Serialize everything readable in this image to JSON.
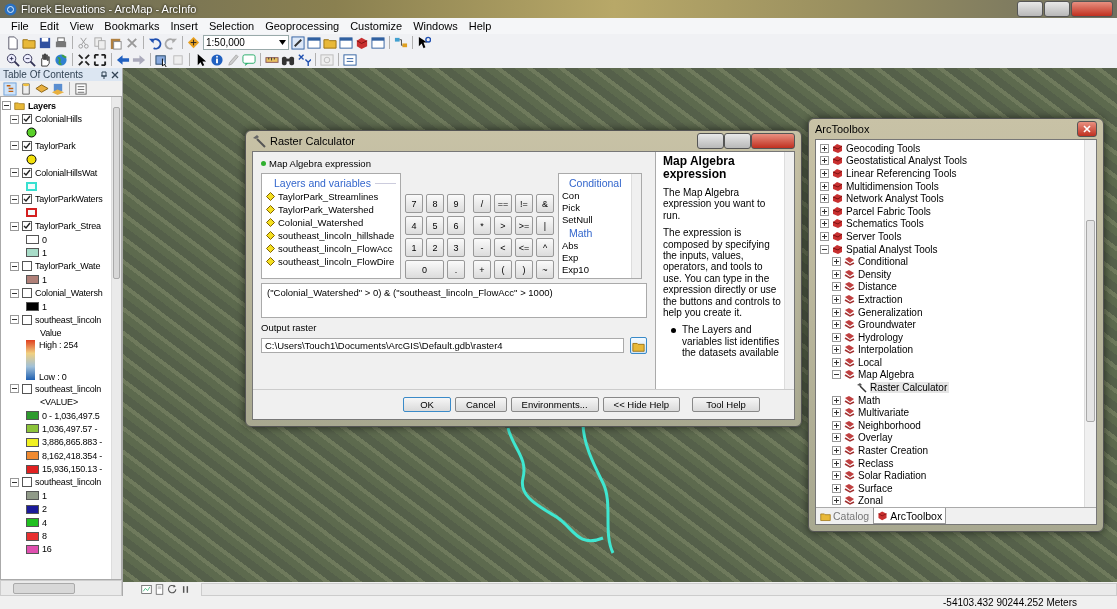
{
  "window": {
    "title": "Florek Elevations - ArcMap - ArcInfo"
  },
  "menu": [
    "File",
    "Edit",
    "View",
    "Bookmarks",
    "Insert",
    "Selection",
    "Geoprocessing",
    "Customize",
    "Windows",
    "Help"
  ],
  "toolbar": {
    "scale": "1:50,000"
  },
  "toc": {
    "title": "Table Of Contents",
    "root": {
      "label": "Layers",
      "expanded": true
    },
    "layers": [
      {
        "label": "ColonialHills",
        "checked": true,
        "expanded": true,
        "legend": [
          {
            "kind": "point",
            "color": "#5ad02a"
          }
        ]
      },
      {
        "label": "TaylorPark",
        "checked": true,
        "expanded": true,
        "legend": [
          {
            "kind": "point",
            "color": "#f2e00a"
          }
        ]
      },
      {
        "label": "ColonialHillsWat",
        "checked": true,
        "expanded": true,
        "legend": [
          {
            "kind": "outline",
            "color": "#38e0d0"
          }
        ]
      },
      {
        "label": "TaylorParkWaters",
        "checked": true,
        "expanded": true,
        "legend": [
          {
            "kind": "outline",
            "color": "#d42020"
          }
        ]
      },
      {
        "label": "TaylorPark_Strea",
        "checked": true,
        "expanded": true,
        "legend": [
          {
            "kind": "swatch",
            "color": "#ffffff",
            "label": "0"
          },
          {
            "kind": "swatch",
            "color": "#a8dcc8",
            "label": "1"
          }
        ]
      },
      {
        "label": "TaylorPark_Wate",
        "checked": false,
        "expanded": true,
        "legend": [
          {
            "kind": "swatch",
            "color": "#b08078",
            "label": "1"
          }
        ]
      },
      {
        "label": "Colonial_Watersh",
        "checked": false,
        "expanded": true,
        "legend": [
          {
            "kind": "swatch",
            "color": "#000000",
            "label": "1"
          }
        ]
      },
      {
        "label": "southeast_lincoln",
        "checked": false,
        "expanded": true,
        "legend": [
          {
            "kind": "heading",
            "label": "Value"
          },
          {
            "kind": "ramp",
            "high": "High : 254",
            "low": "Low : 0"
          }
        ]
      },
      {
        "label": "southeast_lincoln",
        "checked": false,
        "expanded": true,
        "legend": [
          {
            "kind": "heading",
            "label": "<VALUE>"
          },
          {
            "kind": "swatch",
            "color": "#2e9a2e",
            "label": "0 - 1,036,497.5"
          },
          {
            "kind": "swatch",
            "color": "#8cc43a",
            "label": "1,036,497.57 -"
          },
          {
            "kind": "swatch",
            "color": "#f0f020",
            "label": "3,886,865.883 -"
          },
          {
            "kind": "swatch",
            "color": "#f08a30",
            "label": "8,162,418.354 -"
          },
          {
            "kind": "swatch",
            "color": "#e02020",
            "label": "15,936,150.13 -"
          }
        ]
      },
      {
        "label": "southeast_lincoln",
        "checked": false,
        "expanded": true,
        "legend": [
          {
            "kind": "swatch",
            "color": "#909a88",
            "label": "1"
          },
          {
            "kind": "swatch",
            "color": "#1a1a9a",
            "label": "2"
          },
          {
            "kind": "swatch",
            "color": "#20c020",
            "label": "4"
          },
          {
            "kind": "swatch",
            "color": "#e83030",
            "label": "8"
          },
          {
            "kind": "swatch",
            "color": "#e050b0",
            "label": "16"
          }
        ]
      }
    ]
  },
  "raster_calculator": {
    "title": "Raster Calculator",
    "section_label": "Map Algebra expression",
    "layers_heading": "Layers and variables",
    "layers": [
      "TaylorPark_Streamlines",
      "TaylorPark_Watershed",
      "Colonial_Watershed",
      "southeast_lincoln_hillshade",
      "southeast_lincoln_FlowAcc",
      "southeast_lincoln_FlowDire"
    ],
    "keypad_digits": [
      "7",
      "8",
      "9",
      "4",
      "5",
      "6",
      "1",
      "2",
      "3",
      "0",
      "."
    ],
    "keypad_operators": [
      "/",
      "==",
      "!=",
      "&",
      "*",
      ">",
      ">=",
      "|",
      "-",
      "<",
      "<=",
      "^",
      "+",
      "(",
      ")",
      "~"
    ],
    "functions": [
      {
        "kind": "heading",
        "label": "Conditional"
      },
      {
        "kind": "item",
        "label": "Con"
      },
      {
        "kind": "item",
        "label": "Pick"
      },
      {
        "kind": "item",
        "label": "SetNull"
      },
      {
        "kind": "heading",
        "label": "Math"
      },
      {
        "kind": "item",
        "label": "Abs"
      },
      {
        "kind": "item",
        "label": "Exp"
      },
      {
        "kind": "item",
        "label": "Exp10"
      }
    ],
    "expression": "(\"Colonial_Watershed\" > 0) & (\"southeast_lincoln_FlowAcc\" > 1000)",
    "output_label": "Output raster",
    "output_value": "C:\\Users\\Touch1\\Documents\\ArcGIS\\Default.gdb\\raster4",
    "help": {
      "title": "Map Algebra expression",
      "paragraphs": [
        "The Map Algebra expression you want to run.",
        "The expression is composed by specifying the inputs, values, operators, and tools to use. You can type in the expression directly or use the buttons and controls to help you create it."
      ],
      "bullets": [
        "The Layers and variables list identifies the datasets available"
      ]
    },
    "buttons": [
      {
        "label": "OK",
        "default": true
      },
      {
        "label": "Cancel",
        "default": false
      },
      {
        "label": "Environments...",
        "default": false
      },
      {
        "label": "<< Hide Help",
        "default": false
      },
      {
        "label": "Tool Help",
        "default": false
      }
    ]
  },
  "toolbox": {
    "title": "ArcToolbox",
    "items": [
      {
        "label": "Geocoding Tools",
        "kind": "toolbox",
        "expanded": false
      },
      {
        "label": "Geostatistical Analyst Tools",
        "kind": "toolbox",
        "expanded": false
      },
      {
        "label": "Linear Referencing Tools",
        "kind": "toolbox",
        "expanded": false
      },
      {
        "label": "Multidimension Tools",
        "kind": "toolbox",
        "expanded": false
      },
      {
        "label": "Network Analyst Tools",
        "kind": "toolbox",
        "expanded": false
      },
      {
        "label": "Parcel Fabric Tools",
        "kind": "toolbox",
        "expanded": false
      },
      {
        "label": "Schematics Tools",
        "kind": "toolbox",
        "expanded": false
      },
      {
        "label": "Server Tools",
        "kind": "toolbox",
        "expanded": false
      },
      {
        "label": "Spatial Analyst Tools",
        "kind": "toolbox",
        "expanded": true,
        "children": [
          {
            "label": "Conditional",
            "kind": "toolset",
            "expanded": false
          },
          {
            "label": "Density",
            "kind": "toolset",
            "expanded": false
          },
          {
            "label": "Distance",
            "kind": "toolset",
            "expanded": false
          },
          {
            "label": "Extraction",
            "kind": "toolset",
            "expanded": false
          },
          {
            "label": "Generalization",
            "kind": "toolset",
            "expanded": false
          },
          {
            "label": "Groundwater",
            "kind": "toolset",
            "expanded": false
          },
          {
            "label": "Hydrology",
            "kind": "toolset",
            "expanded": false
          },
          {
            "label": "Interpolation",
            "kind": "toolset",
            "expanded": false
          },
          {
            "label": "Local",
            "kind": "toolset",
            "expanded": false
          },
          {
            "label": "Map Algebra",
            "kind": "toolset",
            "expanded": true,
            "children": [
              {
                "label": "Raster Calculator",
                "kind": "tool"
              }
            ]
          },
          {
            "label": "Math",
            "kind": "toolset",
            "expanded": false
          },
          {
            "label": "Multivariate",
            "kind": "toolset",
            "expanded": false
          },
          {
            "label": "Neighborhood",
            "kind": "toolset",
            "expanded": false
          },
          {
            "label": "Overlay",
            "kind": "toolset",
            "expanded": false
          },
          {
            "label": "Raster Creation",
            "kind": "toolset",
            "expanded": false
          },
          {
            "label": "Reclass",
            "kind": "toolset",
            "expanded": false
          },
          {
            "label": "Solar Radiation",
            "kind": "toolset",
            "expanded": false
          },
          {
            "label": "Surface",
            "kind": "toolset",
            "expanded": false
          },
          {
            "label": "Zonal",
            "kind": "toolset",
            "expanded": false
          }
        ]
      }
    ],
    "tabs": [
      {
        "label": "Catalog",
        "selected": false
      },
      {
        "label": "ArcToolbox",
        "selected": true
      }
    ]
  },
  "status_bar": {
    "coordinates": "-54103.432 90244.252 Meters"
  }
}
